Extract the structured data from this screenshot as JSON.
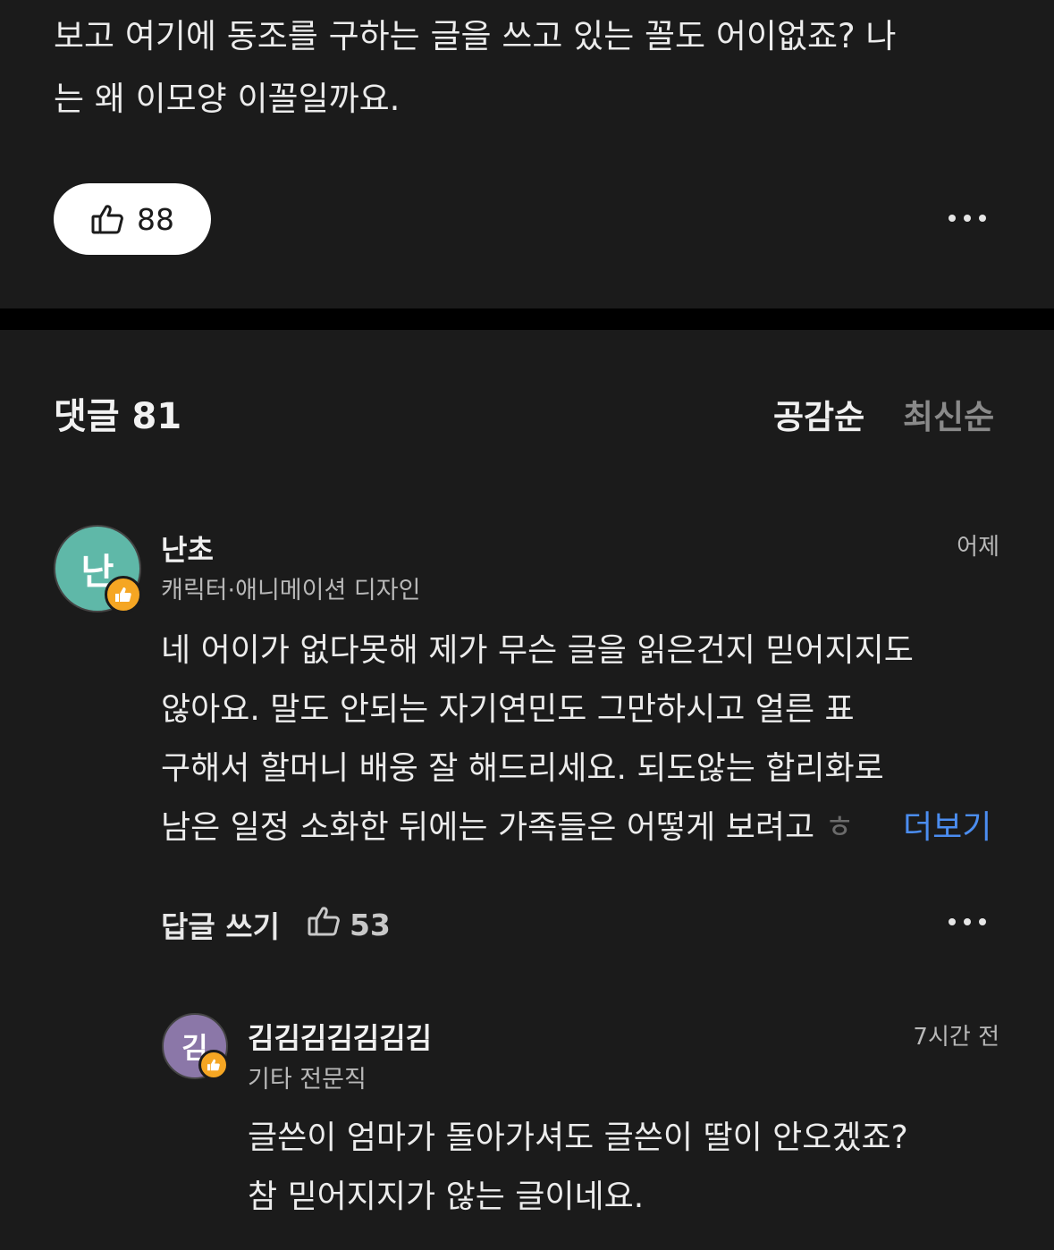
{
  "post": {
    "text_line1": "보고 여기에 동조를 구하는 글을 쓰고 있는 꼴도 어이없죠? 나",
    "text_line2": "는 왜 이모양 이꼴일까요.",
    "likes": "88"
  },
  "comments_header": {
    "label": "댓글 81",
    "sort_popular": "공감순",
    "sort_latest": "최신순"
  },
  "comments": [
    {
      "avatar_text": "난",
      "avatar_color": "#5fb8a8",
      "name": "난초",
      "role": "캐릭터·애니메이션 디자인",
      "time": "어제",
      "lines": [
        "네 어이가 없다못해 제가 무슨 글을 읽은건지 믿어지지도",
        "않아요. 말도 안되는 자기연민도 그만하시고 얼른 표",
        "구해서 할머니 배웅 잘 해드리세요. 되도않는 합리화로",
        "남은 일정 소화한 뒤에는 가족들은 어떻게 보려고"
      ],
      "truncated_char": "ㅎ",
      "see_more": "더보기",
      "reply_label": "답글 쓰기",
      "likes": "53"
    },
    {
      "avatar_text": "김",
      "avatar_color": "#8b77a8",
      "name": "김김김김김김김",
      "role": "기타 전문직",
      "time": "7시간 전",
      "lines": [
        "글쓴이 엄마가 돌아가셔도 글쓴이 딸이 안오겠죠?",
        "참 믿어지지가 않는 글이네요."
      ]
    }
  ],
  "colors": {
    "background": "#1b1b1b",
    "divider": "#000000",
    "link": "#4b8df0",
    "badge": "#f5a623"
  }
}
